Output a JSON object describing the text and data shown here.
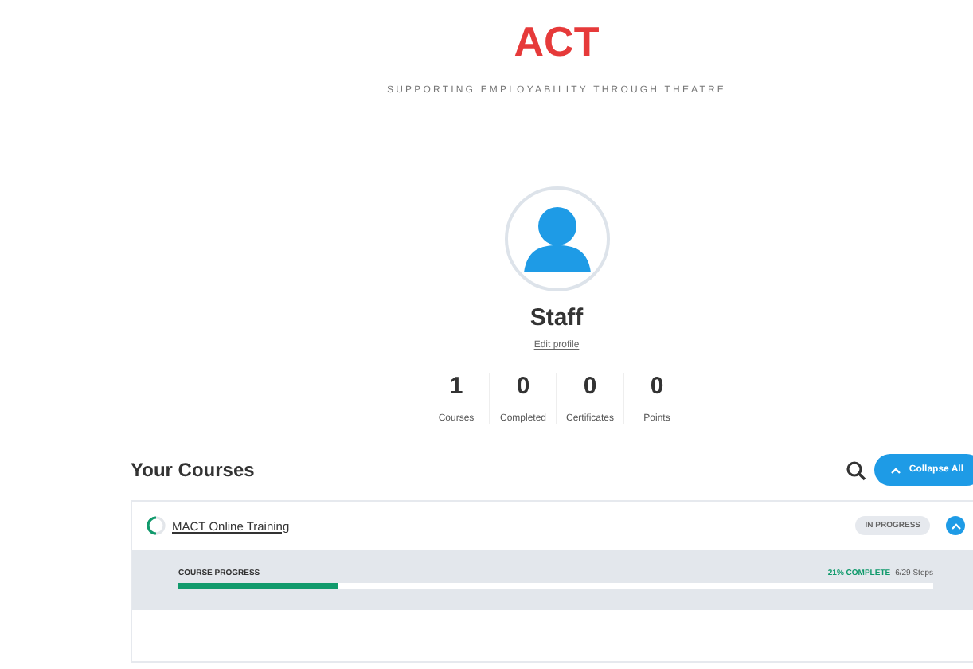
{
  "header": {
    "logo": "ACT",
    "tagline": "SUPPORTING EMPLOYABILITY THROUGH THEATRE"
  },
  "profile": {
    "name": "Staff",
    "edit_link": "Edit profile"
  },
  "stats": [
    {
      "value": "1",
      "label": "Courses"
    },
    {
      "value": "0",
      "label": "Completed"
    },
    {
      "value": "0",
      "label": "Certificates"
    },
    {
      "value": "0",
      "label": "Points"
    }
  ],
  "courses_section": {
    "title": "Your Courses",
    "collapse_button": "Collapse All"
  },
  "courses": [
    {
      "title": "MACT Online Training",
      "status": "IN PROGRESS",
      "expanded": true,
      "progress_label": "COURSE PROGRESS",
      "percent_text": "21% COMPLETE",
      "steps": "6/29 Steps",
      "level": 0.21
    }
  ]
}
